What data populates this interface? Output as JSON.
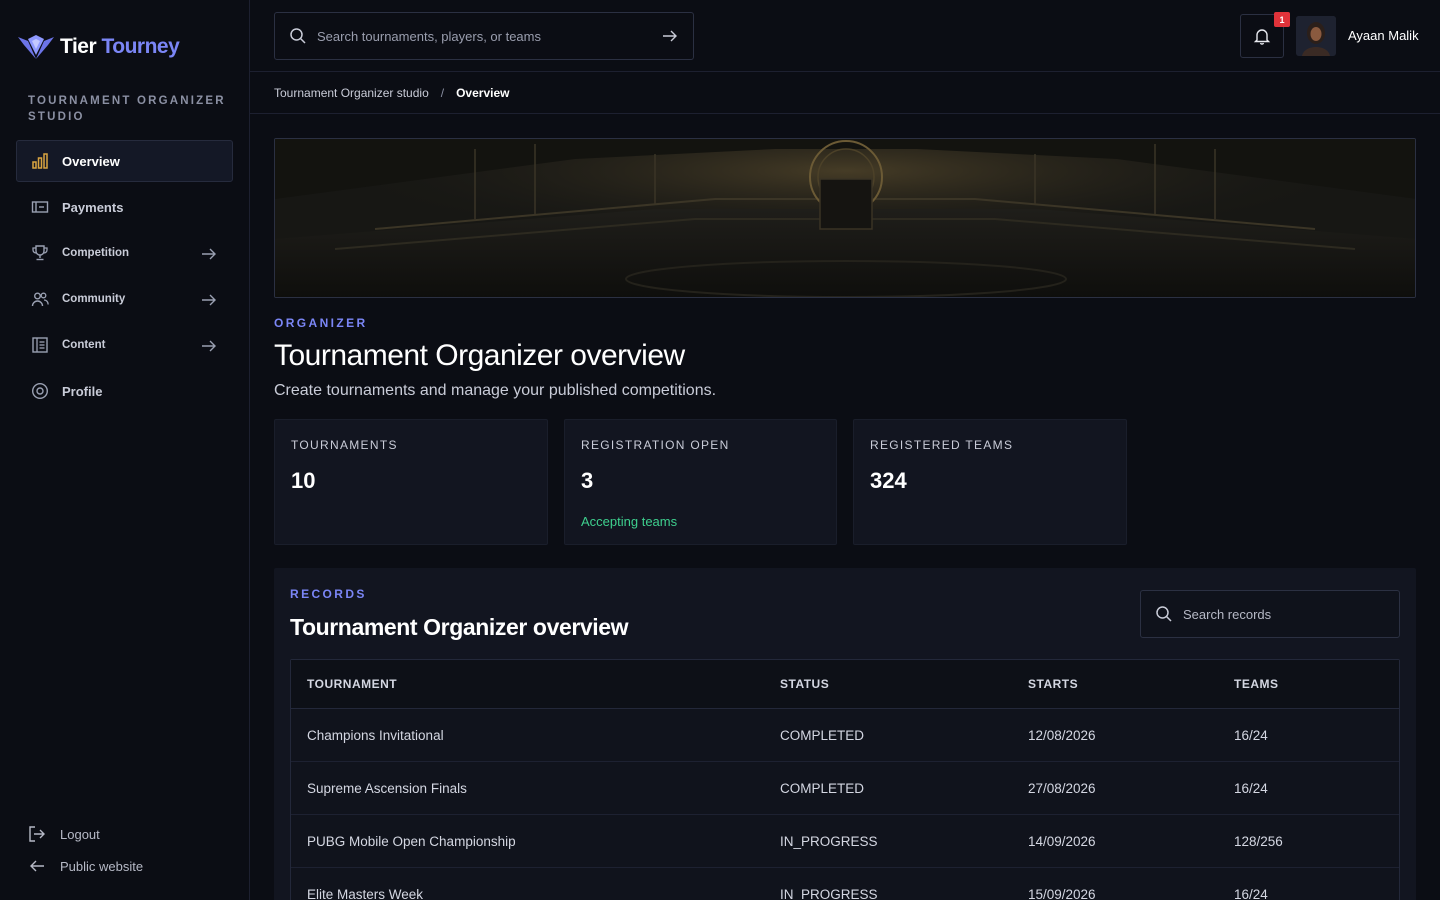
{
  "brand": {
    "name_part1": "Tier",
    "name_part2": "Tourney",
    "accent": "#7b86f6"
  },
  "sidebar": {
    "section_label": "TOURNAMENT ORGANIZER STUDIO",
    "items": [
      {
        "label": "Overview",
        "icon": "bar-chart-icon",
        "active": true
      },
      {
        "label": "Payments",
        "icon": "payment-icon"
      },
      {
        "label": "Competition",
        "icon": "trophy-icon",
        "has_arrow": true
      },
      {
        "label": "Community",
        "icon": "users-icon",
        "has_arrow": true
      },
      {
        "label": "Content",
        "icon": "document-icon",
        "has_arrow": true
      },
      {
        "label": "Profile",
        "icon": "profile-gear-icon"
      }
    ],
    "bottom": {
      "logout": "Logout",
      "public_website": "Public website"
    }
  },
  "topbar": {
    "search_placeholder": "Search tournaments, players, or teams",
    "notification_count": "1",
    "user_name": "Ayaan Malik"
  },
  "breadcrumb": {
    "parent": "Tournament Organizer studio",
    "separator": "/",
    "current": "Overview"
  },
  "header": {
    "eyebrow": "ORGANIZER",
    "title": "Tournament Organizer overview",
    "subtitle": "Create tournaments and manage your published competitions."
  },
  "stats": [
    {
      "label": "TOURNAMENTS",
      "value": "10",
      "note": ""
    },
    {
      "label": "REGISTRATION OPEN",
      "value": "3",
      "note": "Accepting teams"
    },
    {
      "label": "REGISTERED TEAMS",
      "value": "324",
      "note": ""
    }
  ],
  "records": {
    "eyebrow": "RECORDS",
    "title": "Tournament Organizer overview",
    "search_placeholder": "Search records",
    "columns": [
      "TOURNAMENT",
      "STATUS",
      "STARTS",
      "TEAMS"
    ],
    "rows": [
      [
        "Champions Invitational",
        "COMPLETED",
        "12/08/2026",
        "16/24"
      ],
      [
        "Supreme Ascension Finals",
        "COMPLETED",
        "27/08/2026",
        "16/24"
      ],
      [
        "PUBG Mobile Open Championship",
        "IN_PROGRESS",
        "14/09/2026",
        "128/256"
      ],
      [
        "Elite Masters Week",
        "IN_PROGRESS",
        "15/09/2026",
        "16/24"
      ]
    ]
  }
}
